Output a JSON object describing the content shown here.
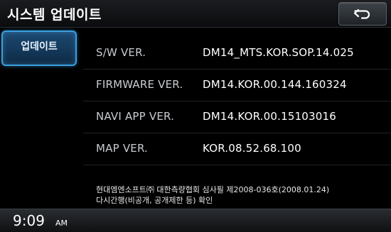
{
  "header": {
    "title": "시스템 업데이트",
    "back_icon": "back-arrow-icon"
  },
  "menu": {
    "items": [
      {
        "label": "업데이트",
        "selected": true
      }
    ]
  },
  "versions": [
    {
      "label": "S/W VER.",
      "value": "DM14_MTS.KOR.SOP.14.025"
    },
    {
      "label": "FIRMWARE VER.",
      "value": "DM14.KOR.00.144.160324"
    },
    {
      "label": "NAVI APP VER.",
      "value": "DM14.KOR.00.15103016"
    },
    {
      "label": "MAP VER.",
      "value": "KOR.08.52.68.100"
    }
  ],
  "notice": {
    "line1": "현대엠엔소프트㈜ 대한측량협회 심사필 제2008-036호(2008.01.24)",
    "line2": "다시간행(비공개, 공개제한 등) 확인"
  },
  "status": {
    "time": "9:09",
    "ampm": "AM"
  },
  "colors": {
    "accent": "#3aa0e0",
    "background": "#000000"
  }
}
